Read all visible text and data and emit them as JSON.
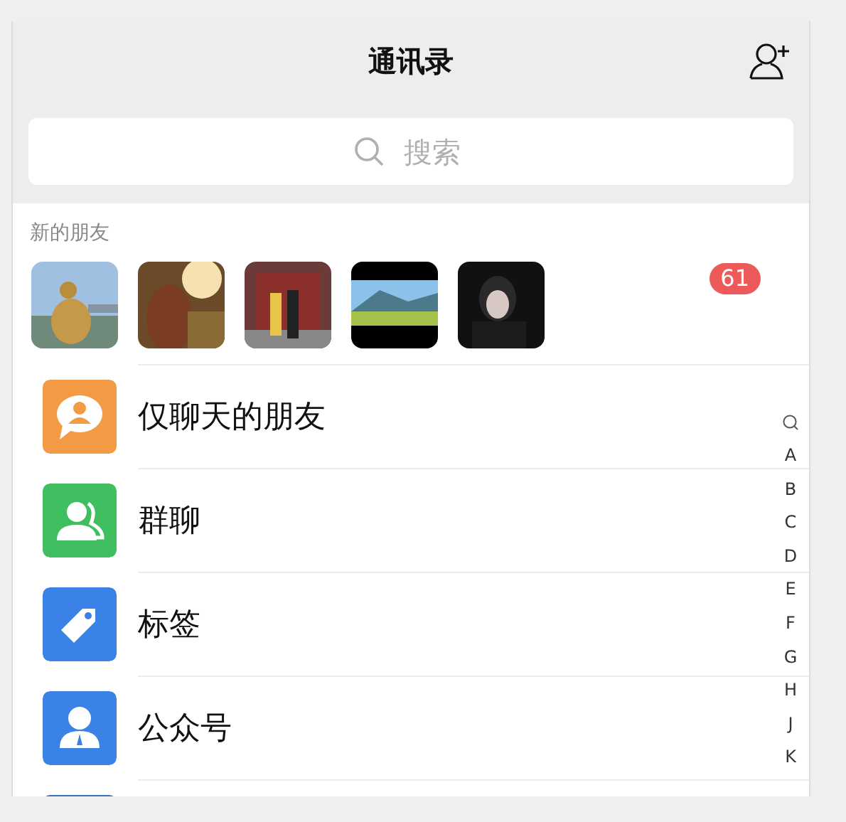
{
  "header": {
    "title": "通讯录",
    "search": {
      "placeholder": "搜索"
    }
  },
  "new_friends": {
    "label": "新的朋友",
    "badge": "61"
  },
  "rows": [
    {
      "kind": "chat",
      "label": "仅聊天的朋友"
    },
    {
      "kind": "group",
      "label": "群聊"
    },
    {
      "kind": "tag",
      "label": "标签"
    },
    {
      "kind": "official",
      "label": "公众号"
    },
    {
      "kind": "partial"
    }
  ],
  "index": [
    "A",
    "B",
    "C",
    "D",
    "E",
    "F",
    "G",
    "H",
    "J",
    "K"
  ]
}
